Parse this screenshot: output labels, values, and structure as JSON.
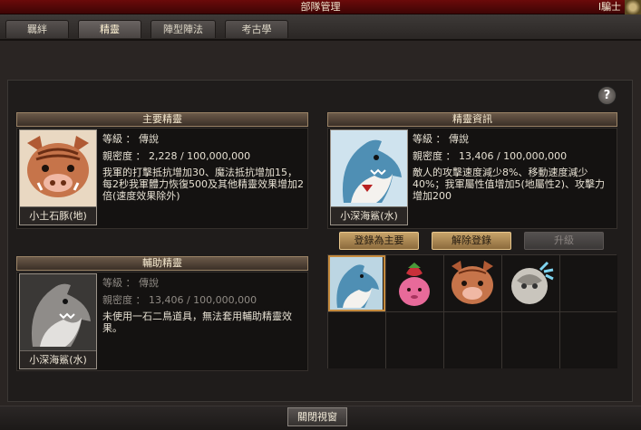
{
  "window": {
    "title": "部隊管理",
    "corner_text": "l騙士"
  },
  "tabs": [
    {
      "label": "羈絆"
    },
    {
      "label": "精靈"
    },
    {
      "label": "陣型陣法"
    },
    {
      "label": "考古學"
    }
  ],
  "main_spirit": {
    "header": "主要精靈",
    "name": "小土石豚(地)",
    "level_label": "等級",
    "level_value": "： 傳說",
    "intimacy_label": "親密度",
    "intimacy_value": "： 2,228 / 100,000,000",
    "description": "我軍的打擊抵抗增加30、魔法抵抗增加15，每2秒我軍體力恢復500及其他精靈效果增加2倍(速度效果除外)"
  },
  "sub_spirit": {
    "header": "輔助精靈",
    "name": "小深海鯊(水)",
    "level_label": "等級",
    "level_value": "： 傳說",
    "intimacy_label": "親密度",
    "intimacy_value": "： 13,406 / 100,000,000",
    "description": "未使用一石二鳥道具，無法套用輔助精靈效果。"
  },
  "spirit_info": {
    "header": "精靈資訊",
    "name": "小深海鯊(水)",
    "level_label": "等級",
    "level_value": "： 傳說",
    "intimacy_label": "親密度",
    "intimacy_value": "： 13,406 / 100,000,000",
    "description": "敵人的攻擊速度減少8%、移動速度減少40%；我軍屬性值增加5(地屬性2)、攻擊力增加200"
  },
  "actions": {
    "register_main": "登錄為主要",
    "unregister": "解除登錄",
    "upgrade": "升級"
  },
  "inventory": {
    "slots": [
      "shark",
      "strawberry",
      "boar",
      "ghost",
      "",
      "",
      "",
      "",
      "",
      ""
    ]
  },
  "footer": {
    "close_label": "關閉視窗"
  },
  "colors": {
    "title_bar": "#6b0a0a",
    "accent_gold": "#c8a46a",
    "selection": "#c58b3e"
  }
}
